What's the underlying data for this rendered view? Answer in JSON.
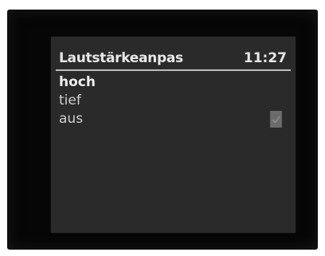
{
  "header": {
    "title": "Lautstärkeanpas",
    "time": "11:27"
  },
  "menu": {
    "items": [
      {
        "label": "hoch",
        "selected": true,
        "checked": false
      },
      {
        "label": "tief",
        "selected": false,
        "checked": false
      },
      {
        "label": "aus",
        "selected": false,
        "checked": true
      }
    ]
  },
  "icons": {
    "checked_marker": "checkmark-icon"
  },
  "colors": {
    "screen_background": "#2a2a2a",
    "text": "#d6d6d6",
    "divider": "#bdbdbd",
    "check_box": "#6b6b6b"
  }
}
